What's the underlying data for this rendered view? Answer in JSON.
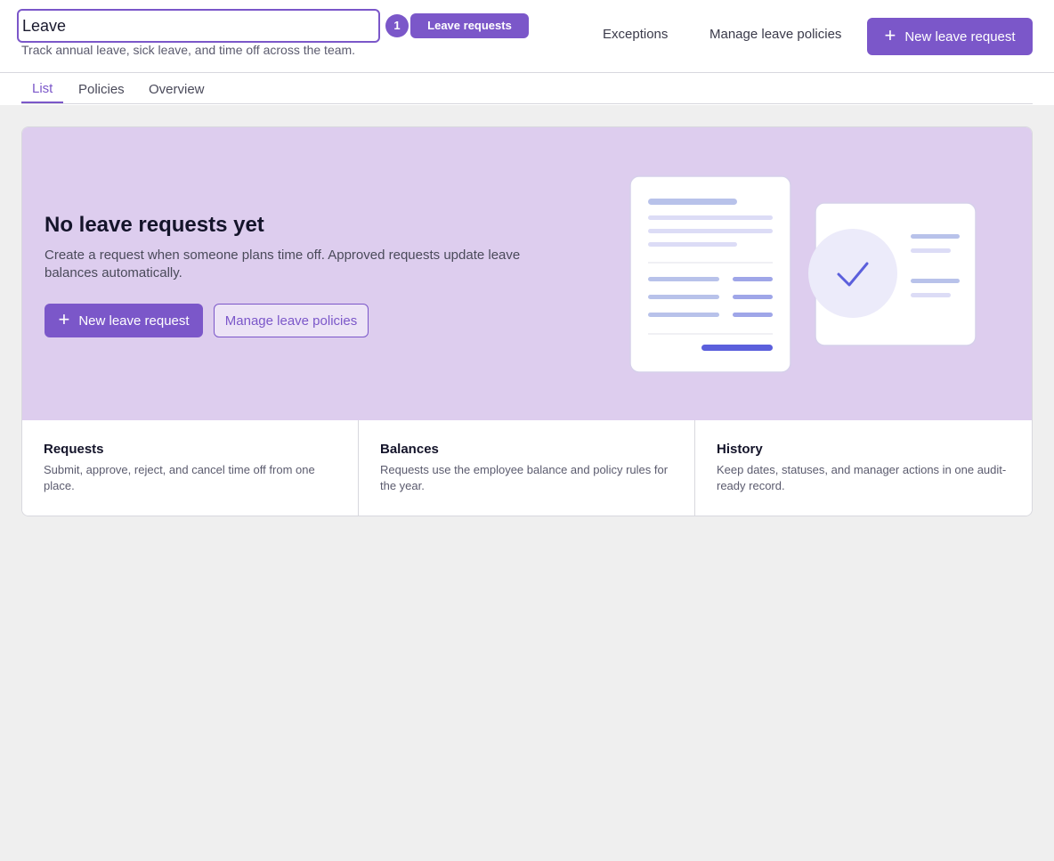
{
  "header": {
    "title_value": "Leave",
    "count_badge": "1",
    "title_pill": "Leave requests",
    "subtitle": "Track annual leave, sick leave, and time off across the team.",
    "links": [
      "Exceptions",
      "Manage leave policies"
    ],
    "primary_button": "New leave request"
  },
  "tabs": [
    {
      "label": "List",
      "active": true
    },
    {
      "label": "Policies",
      "active": false
    },
    {
      "label": "Overview",
      "active": false
    }
  ],
  "empty_state": {
    "title": "No leave requests yet",
    "description": "Create a request when someone plans time off. Approved requests update leave balances automatically.",
    "primary_button": "New leave request",
    "secondary_button": "Manage leave policies"
  },
  "features": [
    {
      "title": "Requests",
      "description": "Submit, approve, reject, and cancel time off from one place."
    },
    {
      "title": "Balances",
      "description": "Requests use the employee balance and policy rules for the year."
    },
    {
      "title": "History",
      "description": "Keep dates, statuses, and manager actions in one audit-ready record."
    }
  ],
  "colors": {
    "accent": "#7b57c9",
    "hero_bg": "#ddcdee",
    "page_bg": "#efefef"
  },
  "icons": {
    "plus": "plus-icon",
    "check": "check-icon"
  }
}
